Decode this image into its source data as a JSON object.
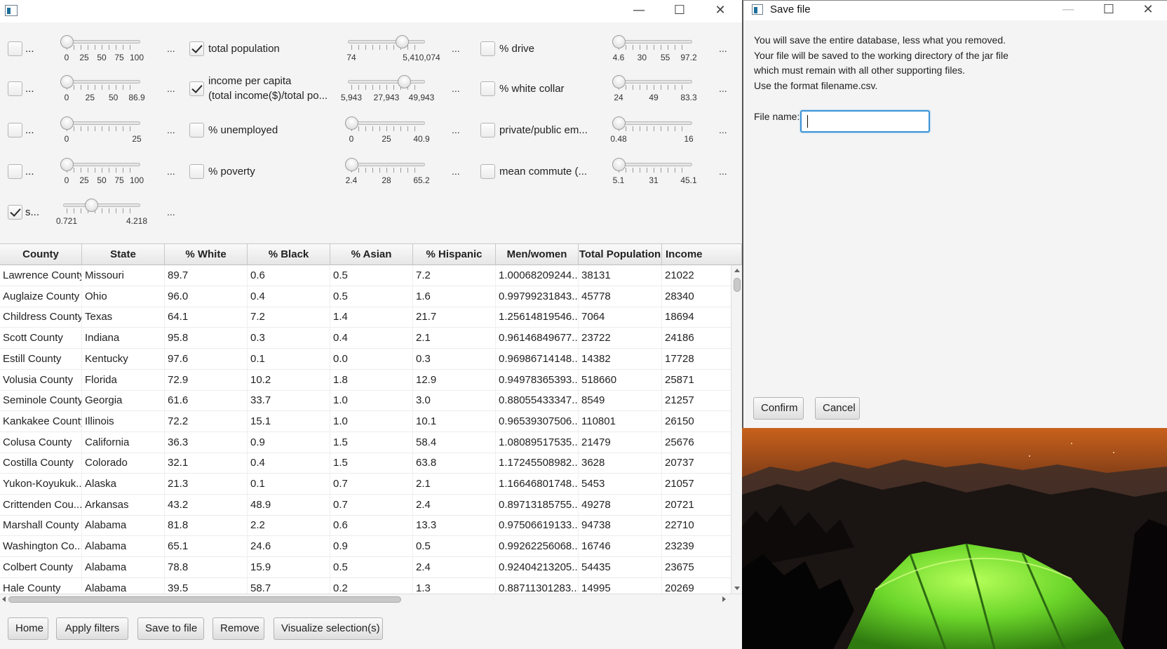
{
  "main_window": {
    "controls": {
      "minimize": "—",
      "maximize": "☐",
      "close": "✕"
    }
  },
  "filters": {
    "col1": [
      {
        "label": "...",
        "checked": false,
        "dots": "...",
        "ticks": [
          "0",
          "25",
          "50",
          "75",
          "100"
        ],
        "value_fraction": 0.0
      },
      {
        "label": "...",
        "checked": false,
        "dots": "...",
        "ticks": [
          "0",
          "25",
          "50",
          "86.9"
        ],
        "value_fraction": 0.0
      },
      {
        "label": "...",
        "checked": false,
        "dots": "...",
        "ticks": [
          "0",
          "25"
        ],
        "value_fraction": 0.0
      },
      {
        "label": "...",
        "checked": false,
        "dots": "...",
        "ticks": [
          "0",
          "25",
          "50",
          "75",
          "100"
        ],
        "value_fraction": 0.0
      },
      {
        "label": "s...",
        "checked": true,
        "dots": "...",
        "ticks": [
          "0.721",
          "4.218"
        ],
        "value_fraction": 0.35
      }
    ],
    "col2": [
      {
        "label": "total population",
        "checked": true,
        "dots": "...",
        "ticks": [
          "74",
          "5,410,074"
        ],
        "value_fraction": 0.72
      },
      {
        "label": "income per capita",
        "label2": "(total income($)/total po...",
        "checked": true,
        "dots": "...",
        "ticks": [
          "5,943",
          "27,943",
          "49,943"
        ],
        "value_fraction": 0.75
      },
      {
        "label": "% unemployed",
        "checked": false,
        "dots": "...",
        "ticks": [
          "0",
          "25",
          "40.9"
        ],
        "value_fraction": 0.0
      },
      {
        "label": "% poverty",
        "checked": false,
        "dots": "...",
        "ticks": [
          "2.4",
          "28",
          "65.2"
        ],
        "value_fraction": 0.0
      }
    ],
    "col3": [
      {
        "label": "% drive",
        "checked": false,
        "dots": "...",
        "ticks": [
          "4.6",
          "30",
          "55",
          "97.2"
        ],
        "value_fraction": 0.0
      },
      {
        "label": "% white collar",
        "checked": false,
        "dots": "...",
        "ticks": [
          "24",
          "49",
          "83.3"
        ],
        "value_fraction": 0.0
      },
      {
        "label": "private/public em...",
        "checked": false,
        "dots": "...",
        "ticks": [
          "0.48",
          "16"
        ],
        "value_fraction": 0.0
      },
      {
        "label": "mean commute (...",
        "checked": false,
        "dots": "...",
        "ticks": [
          "5.1",
          "31",
          "45.1"
        ],
        "value_fraction": 0.0
      }
    ]
  },
  "table": {
    "columns": [
      "County",
      "State",
      "% White",
      "% Black",
      "% Asian",
      "% Hispanic",
      "Men/women",
      "Total Population",
      "Income"
    ],
    "rows": [
      [
        "Lawrence County",
        "Missouri",
        "89.7",
        "0.6",
        "0.5",
        "7.2",
        "1.00068209244...",
        "38131",
        "21022"
      ],
      [
        "Auglaize County",
        "Ohio",
        "96.0",
        "0.4",
        "0.5",
        "1.6",
        "0.99799231843...",
        "45778",
        "28340"
      ],
      [
        "Childress County",
        "Texas",
        "64.1",
        "7.2",
        "1.4",
        "21.7",
        "1.25614819546...",
        "7064",
        "18694"
      ],
      [
        "Scott County",
        "Indiana",
        "95.8",
        "0.3",
        "0.4",
        "2.1",
        "0.96146849677...",
        "23722",
        "24186"
      ],
      [
        "Estill County",
        "Kentucky",
        "97.6",
        "0.1",
        "0.0",
        "0.3",
        "0.96986714148...",
        "14382",
        "17728"
      ],
      [
        "Volusia County",
        "Florida",
        "72.9",
        "10.2",
        "1.8",
        "12.9",
        "0.94978365393...",
        "518660",
        "25871"
      ],
      [
        "Seminole County",
        "Georgia",
        "61.6",
        "33.7",
        "1.0",
        "3.0",
        "0.88055433347...",
        "8549",
        "21257"
      ],
      [
        "Kankakee County",
        "Illinois",
        "72.2",
        "15.1",
        "1.0",
        "10.1",
        "0.96539307506...",
        "110801",
        "26150"
      ],
      [
        "Colusa County",
        "California",
        "36.3",
        "0.9",
        "1.5",
        "58.4",
        "1.08089517535...",
        "21479",
        "25676"
      ],
      [
        "Costilla County",
        "Colorado",
        "32.1",
        "0.4",
        "1.5",
        "63.8",
        "1.17245508982...",
        "3628",
        "20737"
      ],
      [
        "Yukon-Koyukuk...",
        "Alaska",
        "21.3",
        "0.1",
        "0.7",
        "2.1",
        "1.16646801748...",
        "5453",
        "21057"
      ],
      [
        "Crittenden Cou...",
        "Arkansas",
        "43.2",
        "48.9",
        "0.7",
        "2.4",
        "0.89713185755...",
        "49278",
        "20721"
      ],
      [
        "Marshall County",
        "Alabama",
        "81.8",
        "2.2",
        "0.6",
        "13.3",
        "0.97506619133...",
        "94738",
        "22710"
      ],
      [
        "Washington Co...",
        "Alabama",
        "65.1",
        "24.6",
        "0.9",
        "0.5",
        "0.99262256068...",
        "16746",
        "23239"
      ],
      [
        "Colbert County",
        "Alabama",
        "78.8",
        "15.9",
        "0.5",
        "2.4",
        "0.92404213205...",
        "54435",
        "23675"
      ],
      [
        "Hale County",
        "Alabama",
        "39.5",
        "58.7",
        "0.2",
        "1.3",
        "0.88711301283...",
        "14995",
        "20269"
      ]
    ]
  },
  "toolbar": {
    "buttons": [
      "Home",
      "Apply filters",
      "Save to file",
      "Remove",
      "Visualize selection(s)"
    ]
  },
  "save_dialog": {
    "title": "Save file",
    "message_lines": [
      "You will save the entire database, less what you removed.",
      "Your file will be saved to the working directory of the jar file",
      "which must remain with all other supporting files.",
      "Use the format filename.csv."
    ],
    "file_name_label": "File name:",
    "file_name_value": "",
    "confirm_label": "Confirm",
    "cancel_label": "Cancel",
    "controls": {
      "minimize": "—",
      "maximize": "☐",
      "close": "✕"
    }
  },
  "colors": {
    "accent": "#3a93d6",
    "window_bg": "#f4f4f4",
    "tent_green": "#7fe03a",
    "sky_orange": "#c9611c"
  }
}
